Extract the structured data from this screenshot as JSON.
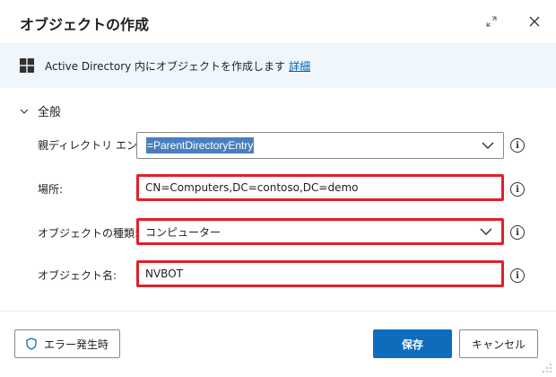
{
  "dialog": {
    "title": "オブジェクトの作成"
  },
  "banner": {
    "text": "Active Directory 内にオブジェクトを作成します",
    "link": "詳細"
  },
  "section": {
    "label": "全般",
    "expanded": true
  },
  "fields": {
    "parent_entry": {
      "label": "親ディレクトリ エントリ:",
      "value": "=ParentDirectoryEntry"
    },
    "location": {
      "label": "場所:",
      "value": "CN=Computers,DC=contoso,DC=demo"
    },
    "object_type": {
      "label": "オブジェクトの種類:",
      "value": "コンピューター"
    },
    "object_name": {
      "label": "オブジェクト名:",
      "value": "NVBOT"
    }
  },
  "info_glyph": "i",
  "footer": {
    "error_button": "エラー発生時",
    "save_button": "保存",
    "cancel_button": "キャンセル"
  },
  "colors": {
    "accent": "#0f6cbd",
    "highlight_border": "#e0202a",
    "banner_bg": "#eff6fc",
    "selection": "#4a7fbf",
    "link": "#0062b1"
  }
}
